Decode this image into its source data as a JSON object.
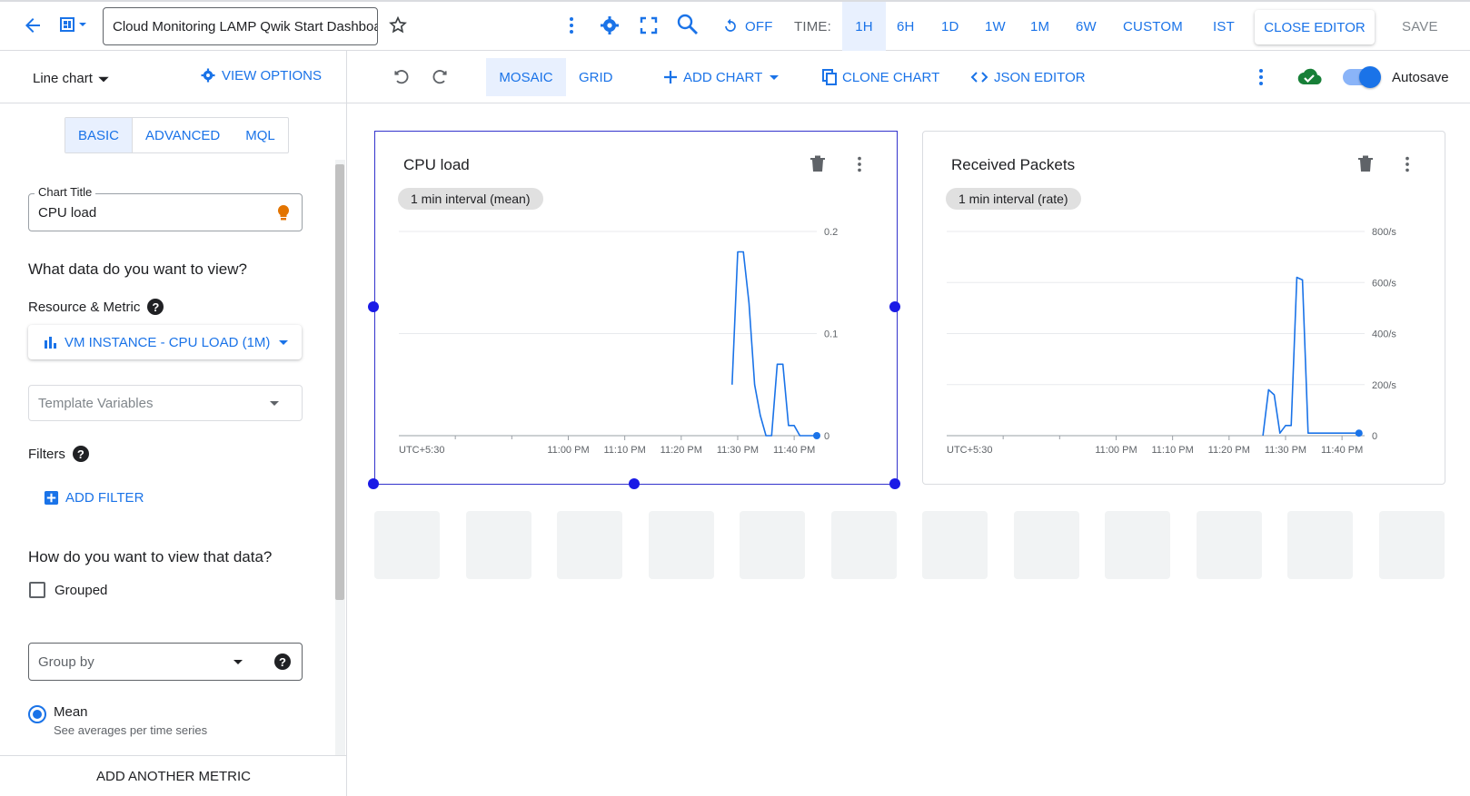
{
  "topbar": {
    "dashboard_title": "Cloud Monitoring LAMP Qwik Start Dashboard",
    "refresh_label": "OFF",
    "time_label": "TIME:",
    "time_ranges": [
      "1H",
      "6H",
      "1D",
      "1W",
      "1M",
      "6W"
    ],
    "custom_label": "CUSTOM",
    "timezone": "IST",
    "close_editor": "CLOSE EDITOR",
    "save": "SAVE"
  },
  "left_panel": {
    "chart_type": "Line chart",
    "view_options": "VIEW OPTIONS",
    "tabs": [
      "BASIC",
      "ADVANCED",
      "MQL"
    ],
    "chart_title_label": "Chart Title",
    "chart_title_value": "CPU load",
    "q_data": "What data do you want to view?",
    "resource_metric": "Resource & Metric",
    "metric_button": "VM INSTANCE - CPU LOAD (1M)",
    "template_variables_placeholder": "Template Variables",
    "filters": "Filters",
    "add_filter": "ADD FILTER",
    "q_view": "How do you want to view that data?",
    "grouped": "Grouped",
    "group_by_placeholder": "Group by",
    "mean_label": "Mean",
    "mean_desc": "See averages per time series",
    "add_another_metric": "ADD ANOTHER METRIC"
  },
  "toolbar": {
    "mosaic": "MOSAIC",
    "grid": "GRID",
    "add_chart": "ADD CHART",
    "clone_chart": "CLONE CHART",
    "json_editor": "JSON EDITOR",
    "autosave": "Autosave"
  },
  "colors": {
    "accent": "#1a73e8",
    "line": "#1a73e8",
    "selection": "#1a1ae6",
    "cloud_ok": "#188038"
  },
  "chart_data": [
    {
      "type": "line",
      "title": "CPU load",
      "chip": "1 min interval (mean)",
      "x_labels": [
        "UTC+5:30",
        "11:00 PM",
        "11:10 PM",
        "11:20 PM",
        "11:30 PM",
        "11:40 PM"
      ],
      "y_ticks": [
        "0.2",
        "0.1",
        "0"
      ],
      "ylim": [
        0,
        0.2
      ],
      "x_minutes": [
        29,
        30,
        31,
        32,
        33,
        34,
        35,
        36,
        37,
        38,
        39,
        40,
        41,
        42,
        43,
        44
      ],
      "values": [
        0.05,
        0.18,
        0.18,
        0.13,
        0.05,
        0.02,
        0.0,
        0.0,
        0.07,
        0.07,
        0.01,
        0.01,
        0.0,
        0.0,
        0.0,
        0.0
      ]
    },
    {
      "type": "line",
      "title": "Received Packets",
      "chip": "1 min interval (rate)",
      "x_labels": [
        "UTC+5:30",
        "11:00 PM",
        "11:10 PM",
        "11:20 PM",
        "11:30 PM",
        "11:40 PM"
      ],
      "y_ticks": [
        "800/s",
        "600/s",
        "400/s",
        "200/s",
        "0"
      ],
      "ylim": [
        0,
        800
      ],
      "x_minutes": [
        26,
        27,
        28,
        29,
        30,
        31,
        32,
        33,
        34,
        35,
        36,
        37,
        38,
        39,
        40,
        41,
        42,
        43
      ],
      "values": [
        0,
        180,
        160,
        10,
        40,
        40,
        620,
        610,
        10,
        10,
        10,
        10,
        10,
        10,
        10,
        10,
        10,
        10
      ]
    }
  ]
}
